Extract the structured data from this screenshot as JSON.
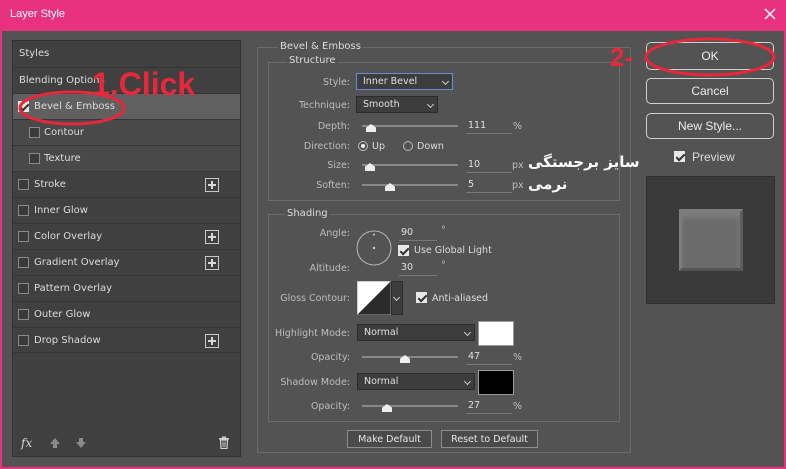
{
  "window": {
    "title": "Layer Style"
  },
  "left_panel": {
    "items": [
      {
        "label": "Styles"
      },
      {
        "label": "Blending Options"
      },
      {
        "label": "Bevel & Emboss",
        "checked": true
      },
      {
        "label": "Contour",
        "checked": false
      },
      {
        "label": "Texture",
        "checked": false
      },
      {
        "label": "Stroke",
        "checked": false
      },
      {
        "label": "Inner Glow",
        "checked": false
      },
      {
        "label": "Color Overlay",
        "checked": false
      },
      {
        "label": "Gradient Overlay",
        "checked": false
      },
      {
        "label": "Pattern Overlay",
        "checked": false
      },
      {
        "label": "Outer Glow",
        "checked": false
      },
      {
        "label": "Drop Shadow",
        "checked": false
      }
    ],
    "fx_label": "fx"
  },
  "bevel": {
    "section_title": "Bevel & Emboss",
    "structure": {
      "title": "Structure",
      "style_label": "Style:",
      "style_value": "Inner Bevel",
      "technique_label": "Technique:",
      "technique_value": "Smooth",
      "depth_label": "Depth:",
      "depth_value": "111",
      "depth_unit": "%",
      "direction_label": "Direction:",
      "up_label": "Up",
      "down_label": "Down",
      "size_label": "Size:",
      "size_value": "10",
      "size_unit": "px",
      "soften_label": "Soften:",
      "soften_value": "5",
      "soften_unit": "px"
    },
    "shading": {
      "title": "Shading",
      "angle_label": "Angle:",
      "angle_value": "90",
      "angle_unit": "°",
      "global_light_label": "Use Global Light",
      "altitude_label": "Altitude:",
      "altitude_value": "30",
      "altitude_unit": "°",
      "gloss_label": "Gloss Contour:",
      "anti_aliased_label": "Anti-aliased",
      "highlight_label": "Highlight Mode:",
      "highlight_value": "Normal",
      "highlight_color": "#ffffff",
      "hopacity_label": "Opacity:",
      "hopacity_value": "47",
      "hopacity_unit": "%",
      "shadow_label": "Shadow Mode:",
      "shadow_value": "Normal",
      "shadow_color": "#000000",
      "sopacity_label": "Opacity:",
      "sopacity_value": "27",
      "sopacity_unit": "%"
    },
    "make_default": "Make Default",
    "reset_default": "Reset to Default"
  },
  "right": {
    "ok": "OK",
    "cancel": "Cancel",
    "new_style": "New Style...",
    "preview_label": "Preview"
  },
  "annotations": {
    "click_label": "1.Click",
    "step2_label": "2-",
    "size_note": "سایز برجستگی",
    "soften_note": "نرمی",
    "color": "#e8273a"
  },
  "colors": {
    "titlebar": "#e8327f",
    "panel": "#535353"
  }
}
